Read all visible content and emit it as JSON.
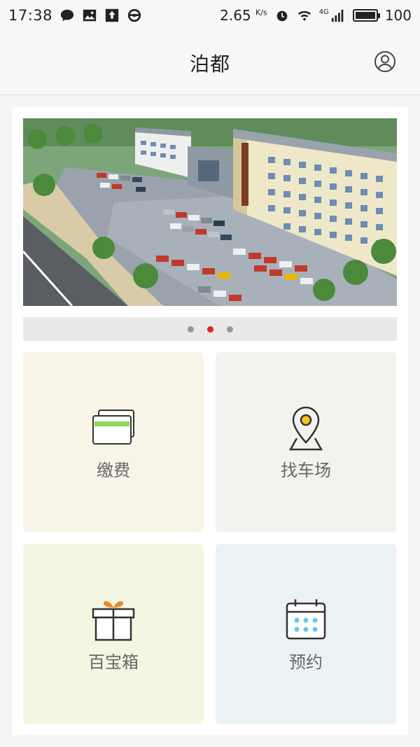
{
  "status_bar": {
    "time": "17:38",
    "speed": "2.65",
    "speed_unit": "K/s",
    "network": "4G",
    "battery": "100",
    "icons": [
      "chat-icon",
      "image-icon",
      "upload-icon",
      "steering-wheel-icon",
      "speed-icon",
      "alarm-icon",
      "wifi-icon",
      "signal-icon",
      "battery-icon"
    ]
  },
  "header": {
    "title": "泊都",
    "profile_icon": "user-profile-icon"
  },
  "banner": {
    "image": "parking-lot-building-illustration",
    "pagination": {
      "count": 3,
      "active_index": 1
    }
  },
  "tiles": [
    {
      "label": "缴费",
      "icon": "payment-card-icon"
    },
    {
      "label": "找车场",
      "icon": "map-location-pin-icon"
    },
    {
      "label": "百宝箱",
      "icon": "gift-box-icon"
    },
    {
      "label": "预约",
      "icon": "calendar-icon"
    }
  ],
  "colors": {
    "accent_red": "#e0201e",
    "card_green": "#8ed45e",
    "pin_yellow": "#f5c518",
    "gift_orange": "#e98b2a",
    "calendar_blue": "#6cc4f0"
  }
}
